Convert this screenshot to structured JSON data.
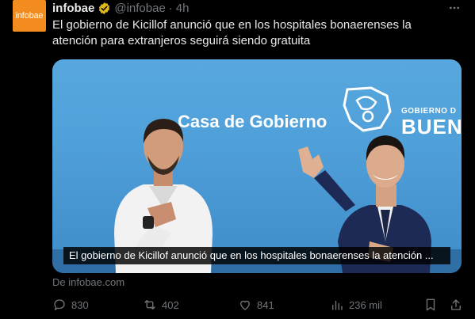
{
  "tweet": {
    "avatar_text": "infobae",
    "author_name": "infobae",
    "handle": "@infobae",
    "separator": "·",
    "time": "4h",
    "text": "El gobierno de Kicillof anunció que en los hospitales bonaerenses la atención para extranjeros seguirá siendo gratuita",
    "source": "De infobae.com"
  },
  "card": {
    "backdrop_text": "Casa de Gobierno",
    "backdrop_gob": "GOBIERNO D",
    "backdrop_buen": "BUEN",
    "caption": "El gobierno de Kicillof anunció que en los hospitales bonaerenses la atención ..."
  },
  "actions": {
    "replies": "830",
    "reposts": "402",
    "likes": "841",
    "views": "236 mil"
  },
  "icons": [
    "verified-icon",
    "more-icon",
    "reply-icon",
    "repost-icon",
    "like-icon",
    "views-icon",
    "bookmark-icon",
    "share-icon"
  ],
  "colors": {
    "brand": "#f28c1e",
    "verified": "#e2b719",
    "muted": "#71767b",
    "text": "#e7e9ea",
    "background": "#000000"
  }
}
